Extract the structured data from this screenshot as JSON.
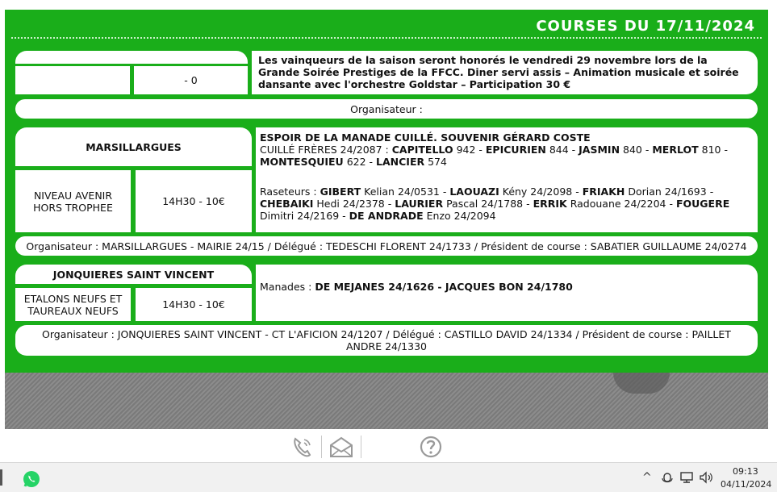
{
  "header": {
    "title": "COURSES DU 17/11/2024"
  },
  "event_notice": {
    "blank_top": "",
    "blank_left": "",
    "mid_value": "- 0",
    "notice_text": "Les vainqueurs de la saison seront honorés le vendredi 29 novembre lors de la Grande Soirée Prestiges de la FFCC. Diner servi assis – Animation musicale et soirée dansante avec l'orchestre Goldstar – Participation 30 €",
    "organiser": "Organisateur :"
  },
  "course1": {
    "town": "MARSILLARGUES",
    "category": "NIVEAU AVENIR HORS TROPHEE",
    "time_price": "14H30 - 10€",
    "title": "ESPOIR DE LA MANADE CUILLÉ. SOUVENIR GÉRARD COSTE",
    "manade": "CUILLÉ FRÈRES 24/2087",
    "bulls": [
      {
        "name": "CAPITELLO",
        "num": "942"
      },
      {
        "name": "EPICURIEN",
        "num": "844"
      },
      {
        "name": "JASMIN",
        "num": "840"
      },
      {
        "name": "MERLOT",
        "num": "810"
      },
      {
        "name": "MONTESQUIEU",
        "num": "622"
      },
      {
        "name": "LANCIER",
        "num": "574"
      }
    ],
    "raseteurs_label": "Raseteurs :",
    "raseteurs": [
      {
        "name": "GIBERT",
        "rest": "Kelian 24/0531"
      },
      {
        "name": "LAOUAZI",
        "rest": "Kény 24/2098"
      },
      {
        "name": "FRIAKH",
        "rest": "Dorian 24/1693"
      },
      {
        "name": "CHEBAIKI",
        "rest": "Hedi 24/2378"
      },
      {
        "name": "LAURIER",
        "rest": "Pascal 24/1788"
      },
      {
        "name": "ERRIK",
        "rest": "Radouane 24/2204"
      },
      {
        "name": "FOUGERE",
        "rest": "Dimitri 24/2169"
      },
      {
        "name": "DE ANDRADE",
        "rest": "Enzo 24/2094"
      }
    ],
    "organiser": "Organisateur : MARSILLARGUES - MAIRIE 24/15 / Délégué : TEDESCHI FLORENT 24/1733 / Président de course : SABATIER GUILLAUME 24/0274"
  },
  "course2": {
    "town": "JONQUIERES SAINT VINCENT",
    "category": "ETALONS NEUFS ET TAUREAUX NEUFS",
    "time_price": "14H30 - 10€",
    "manades_label": "Manades :",
    "manades": "DE MEJANES 24/1626 - JACQUES BON 24/1780",
    "organiser": "Organisateur : JONQUIERES SAINT VINCENT - CT L'AFICION 24/1207 / Délégué : CASTILLO DAVID 24/1334 / Président de course : PAILLET ANDRE 24/1330"
  },
  "bottom_icons": [
    "phone-icon",
    "mail-icon",
    "help-icon"
  ],
  "taskbar": {
    "time": "09:13",
    "date": "04/11/2024"
  },
  "colors": {
    "green": "#1aae1a",
    "white": "#ffffff"
  }
}
